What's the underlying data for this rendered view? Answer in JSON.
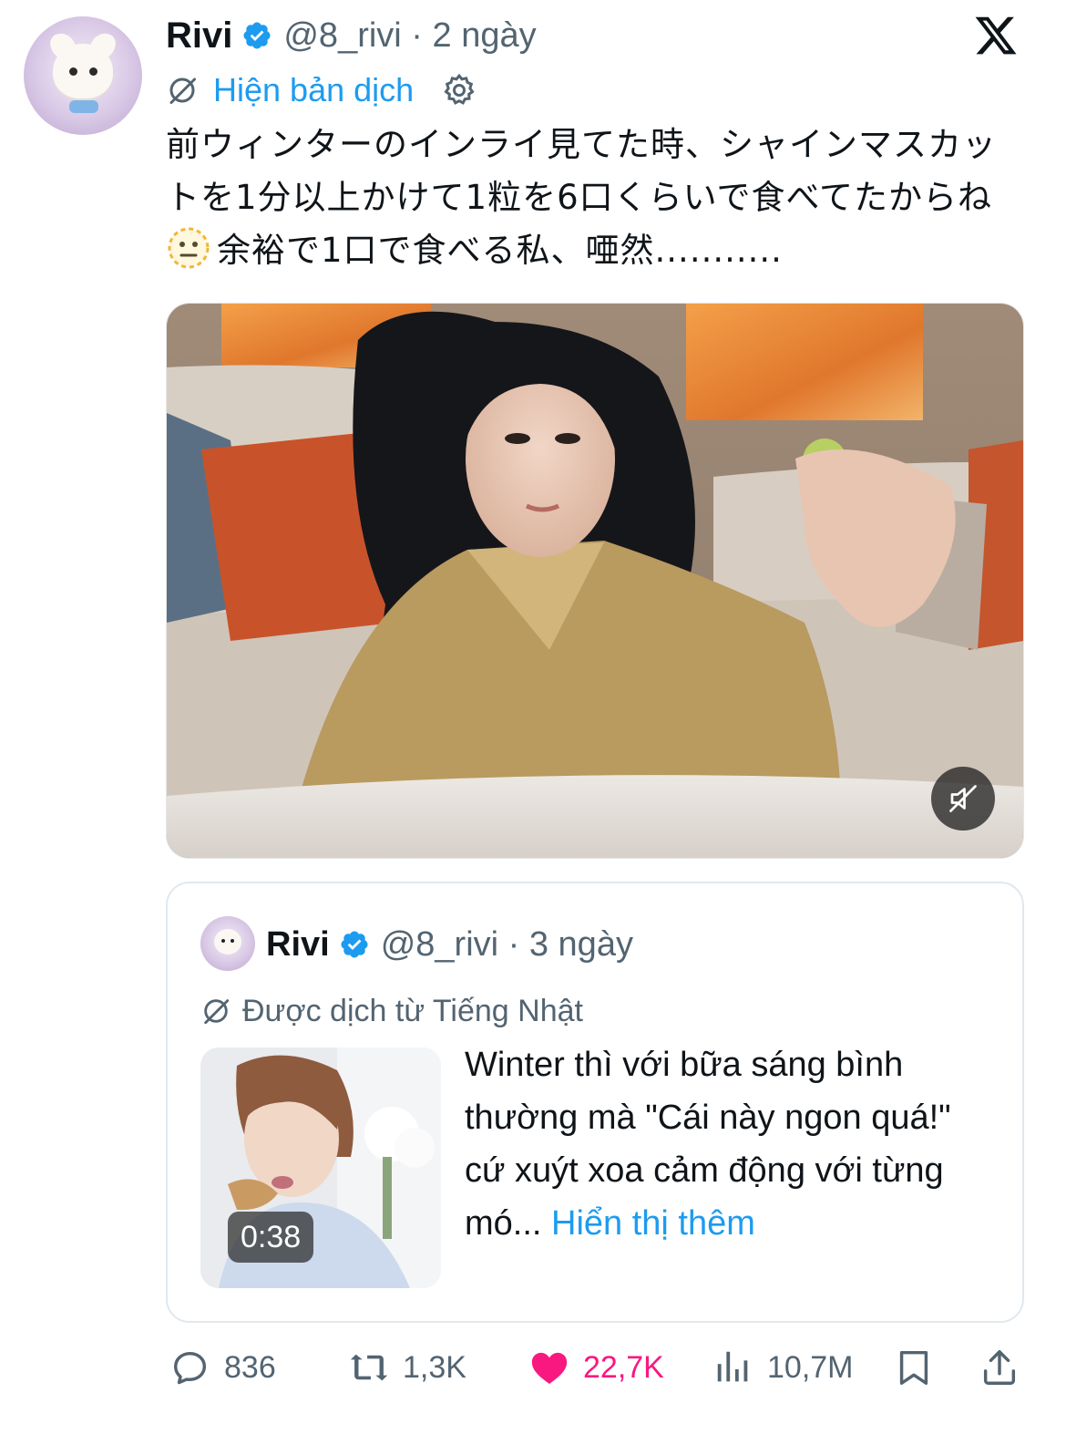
{
  "tweet": {
    "author_name": "Rivi",
    "handle_time": "@8_rivi · 2 ngày",
    "show_translation": "Hiện bản dịch",
    "text_line1": "前ウィンターのインライ見てた時、シャインマスカッ",
    "text_line2": "トを1分以上かけて1粒を6口くらいで食べてたからね",
    "text_line3": "余裕で1口で食べる私、唖然...........",
    "emoji": "dotted-line-face-emoji"
  },
  "quote": {
    "author_name": "Rivi",
    "handle_time": "@8_rivi · 3 ngày",
    "translated_label": "Được dịch từ Tiếng Nhật",
    "video_duration": "0:38",
    "text": "Winter thì với bữa sáng bình thường mà \"Cái này ngon quá!\" cứ xuýt xoa cảm động với từng mó...",
    "show_more": "Hiển thị thêm"
  },
  "actions": {
    "replies": "836",
    "retweets": "1,3K",
    "likes": "22,7K",
    "views": "10,7M"
  },
  "colors": {
    "accent": "#1d9bf0",
    "like": "#f91880",
    "muted": "#536471"
  }
}
